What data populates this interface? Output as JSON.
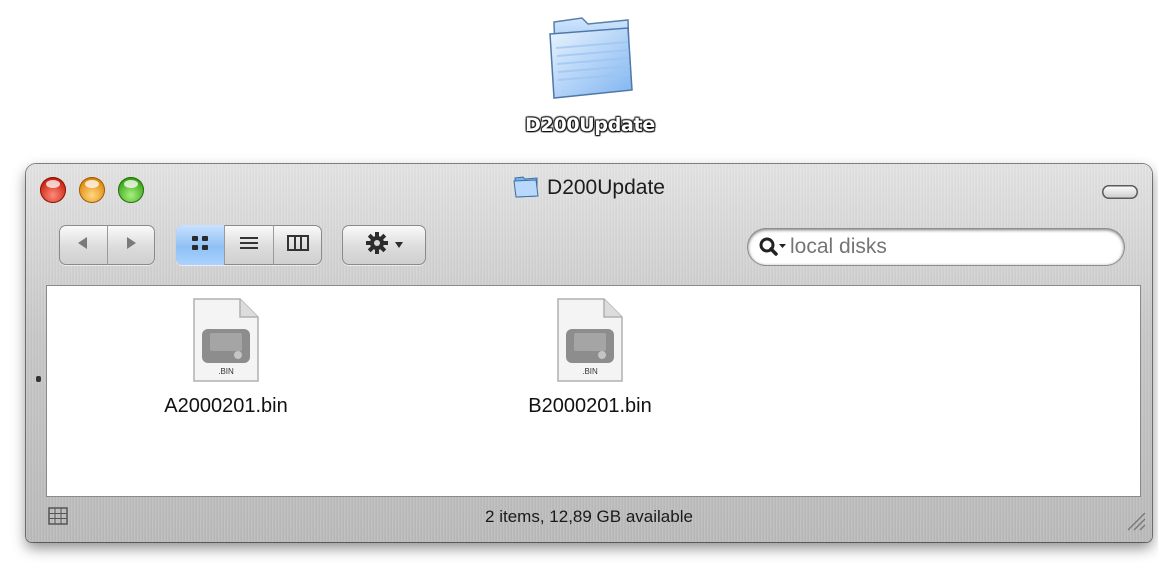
{
  "desktop": {
    "folder_icon": "folder-icon",
    "folder_label": "D200Update"
  },
  "window": {
    "title": "D200Update",
    "title_icon": "folder-icon",
    "controls": [
      "close-button",
      "minimize-button",
      "zoom-button",
      "toolbar-toggle-button"
    ]
  },
  "toolbar": {
    "nav": {
      "back_icon": "back-arrow-icon",
      "forward_icon": "forward-arrow-icon"
    },
    "view_modes": [
      {
        "name": "icon-view",
        "icon": "icon-view-icon",
        "selected": true
      },
      {
        "name": "list-view",
        "icon": "list-view-icon",
        "selected": false
      },
      {
        "name": "column-view",
        "icon": "column-view-icon",
        "selected": false
      }
    ],
    "action_icon": "gear-icon",
    "search": {
      "value": "",
      "placeholder": "local disks",
      "icon": "search-icon"
    }
  },
  "files": [
    {
      "name": "A2000201.bin",
      "badge": ".BIN",
      "icon": "bin-file-icon"
    },
    {
      "name": "B2000201.bin",
      "badge": ".BIN",
      "icon": "bin-file-icon"
    }
  ],
  "status_bar": {
    "text": "2 items, 12,89 GB available"
  },
  "colors": {
    "selection_blue": "#8fc0f4",
    "close_red": "#c8230e",
    "minimize_orange": "#e08a10",
    "zoom_green": "#3ba618"
  }
}
